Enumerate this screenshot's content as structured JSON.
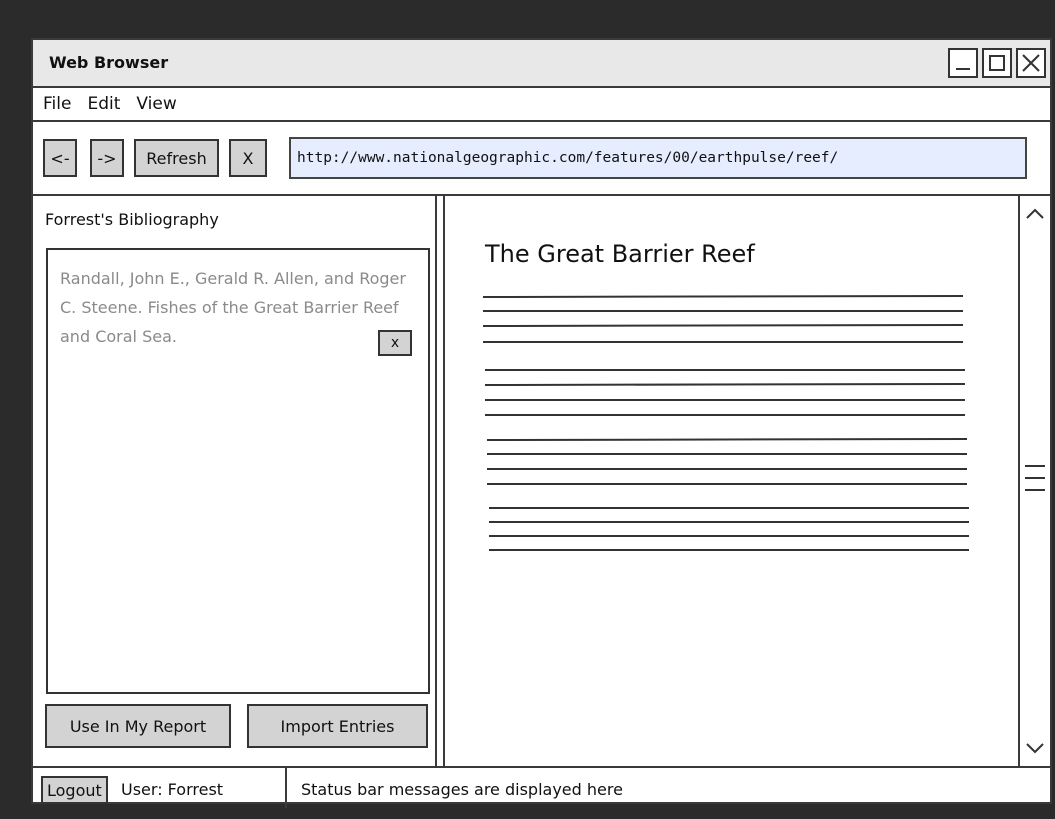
{
  "window": {
    "title": "Web Browser"
  },
  "menu": [
    "File",
    "Edit",
    "View"
  ],
  "toolbar": {
    "back_label": "<-",
    "forward_label": "->",
    "refresh_label": "Refresh",
    "stop_label": "X",
    "url": "http://www.nationalgeographic.com/features/00/earthpulse/reef/"
  },
  "bibliography": {
    "title": "Forrest's Bibliography",
    "entry_text": "Randall, John E., Gerald R. Allen, and Roger C. Steene. Fishes of the Great Barrier Reef and Coral Sea.",
    "entry_remove_label": "x",
    "use_in_report_label": "Use In My Report",
    "import_entries_label": "Import Entries"
  },
  "content": {
    "heading": "The Great Barrier Reef"
  },
  "status": {
    "logout_label": "Logout",
    "user_text": "User: Forrest",
    "message": "Status bar messages are displayed here"
  }
}
